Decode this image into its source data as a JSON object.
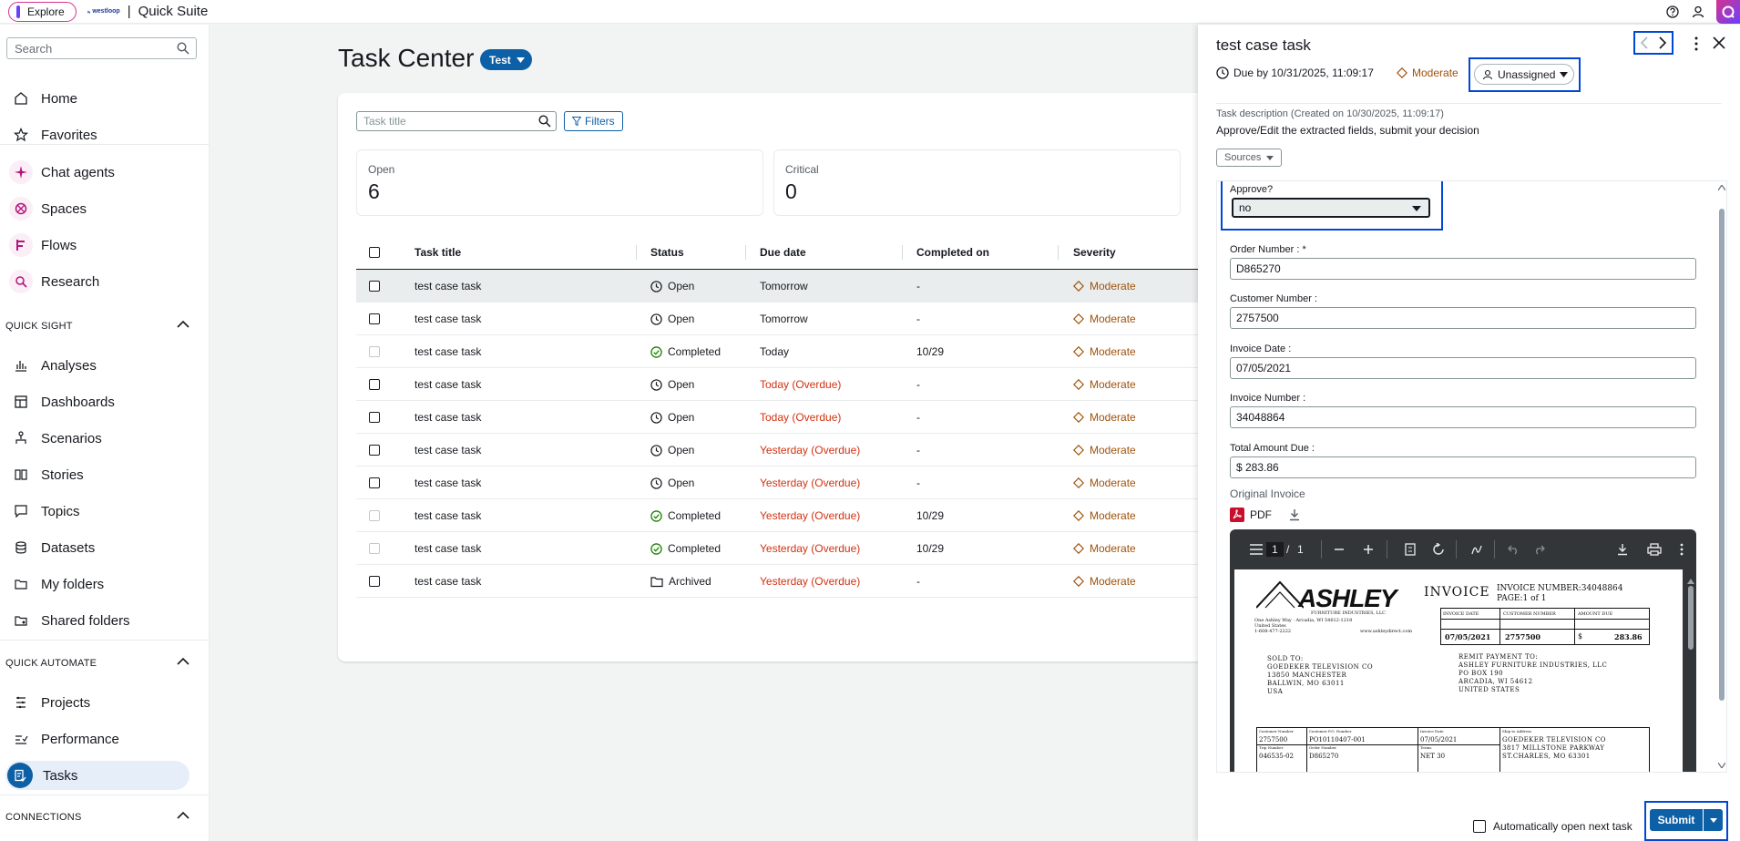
{
  "topbar": {
    "explore_label": "Explore",
    "brand_logo_text": "westloop",
    "brand_separator": "|",
    "app_name": "Quick Suite",
    "icons": [
      "help-icon",
      "user-icon",
      "quick-assistant-icon"
    ]
  },
  "sidebar": {
    "search_placeholder": "Search",
    "top_items": [
      {
        "label": "Home",
        "icon": "home-icon"
      },
      {
        "label": "Favorites",
        "icon": "star-icon"
      }
    ],
    "ai_items": [
      {
        "label": "Chat agents",
        "icon": "sparkle-icon"
      },
      {
        "label": "Spaces",
        "icon": "spaces-icon"
      },
      {
        "label": "Flows",
        "icon": "flows-icon"
      },
      {
        "label": "Research",
        "icon": "research-icon"
      }
    ],
    "quicksight_header": "QUICK SIGHT",
    "quicksight_items": [
      {
        "label": "Analyses"
      },
      {
        "label": "Dashboards"
      },
      {
        "label": "Scenarios"
      },
      {
        "label": "Stories"
      },
      {
        "label": "Topics"
      },
      {
        "label": "Datasets"
      },
      {
        "label": "My folders"
      },
      {
        "label": "Shared folders"
      }
    ],
    "automate_header": "QUICK AUTOMATE",
    "automate_items": [
      {
        "label": "Projects"
      },
      {
        "label": "Performance"
      },
      {
        "label": "Tasks"
      }
    ],
    "connections_header": "CONNECTIONS"
  },
  "main": {
    "title": "Task Center",
    "badge": "Test",
    "search_placeholder": "Task title",
    "filters_label": "Filters",
    "stats": [
      {
        "label": "Open",
        "value": "6"
      },
      {
        "label": "Critical",
        "value": "0"
      }
    ],
    "columns": [
      "Task title",
      "Status",
      "Due date",
      "Completed on",
      "Severity"
    ],
    "rows": [
      {
        "title": "test case task",
        "status": "Open",
        "status_icon": "clock-icon",
        "due": "Tomorrow",
        "overdue": false,
        "completed": "-",
        "severity": "Moderate",
        "selected": true
      },
      {
        "title": "test case task",
        "status": "Open",
        "status_icon": "clock-icon",
        "due": "Tomorrow",
        "overdue": false,
        "completed": "-",
        "severity": "Moderate"
      },
      {
        "title": "test case task",
        "status": "Completed",
        "status_icon": "check-circle-icon",
        "due": "Today",
        "overdue": false,
        "completed": "10/29",
        "severity": "Moderate"
      },
      {
        "title": "test case task",
        "status": "Open",
        "status_icon": "clock-icon",
        "due": "Today (Overdue)",
        "overdue": true,
        "completed": "-",
        "severity": "Moderate"
      },
      {
        "title": "test case task",
        "status": "Open",
        "status_icon": "clock-icon",
        "due": "Today (Overdue)",
        "overdue": true,
        "completed": "-",
        "severity": "Moderate"
      },
      {
        "title": "test case task",
        "status": "Open",
        "status_icon": "clock-icon",
        "due": "Yesterday (Overdue)",
        "overdue": true,
        "completed": "-",
        "severity": "Moderate"
      },
      {
        "title": "test case task",
        "status": "Open",
        "status_icon": "clock-icon",
        "due": "Yesterday (Overdue)",
        "overdue": true,
        "completed": "-",
        "severity": "Moderate"
      },
      {
        "title": "test case task",
        "status": "Completed",
        "status_icon": "check-circle-icon",
        "due": "Yesterday (Overdue)",
        "overdue": true,
        "completed": "10/29",
        "severity": "Moderate"
      },
      {
        "title": "test case task",
        "status": "Completed",
        "status_icon": "check-circle-icon",
        "due": "Yesterday (Overdue)",
        "overdue": true,
        "completed": "10/29",
        "severity": "Moderate"
      },
      {
        "title": "test case task",
        "status": "Archived",
        "status_icon": "folder-icon",
        "due": "Yesterday (Overdue)",
        "overdue": true,
        "completed": "-",
        "severity": "Moderate"
      }
    ]
  },
  "panel": {
    "title": "test case task",
    "due": "Due by 10/31/2025, 11:09:17",
    "severity": "Moderate",
    "assignee": "Unassigned",
    "description_label": "Task description (Created on 10/30/2025, 11:09:17)",
    "description": "Approve/Edit the extracted fields, submit your decision",
    "sources_label": "Sources",
    "approve_label": "Approve?",
    "approve_value": "no",
    "fields": [
      {
        "label": "Order Number : *",
        "value": "D865270"
      },
      {
        "label": "Customer Number :",
        "value": "2757500"
      },
      {
        "label": "Invoice Date :",
        "value": "07/05/2021"
      },
      {
        "label": "Invoice Number :",
        "value": "34048864"
      },
      {
        "label": "Total Amount Due :",
        "value": "$ 283.86"
      }
    ],
    "original_invoice_label": "Original Invoice",
    "pdf_label": "PDF",
    "pdf_viewer": {
      "page_current": "1",
      "page_sep": "/",
      "page_total": "1"
    },
    "invoice": {
      "brand": "ASHLEY",
      "brand_sub": "FURNITURE INDUSTRIES, LLC",
      "title": "INVOICE",
      "number_line": "INVOICE NUMBER:34048864",
      "page_line": "PAGE:1 of 1",
      "address_lines": [
        "One Ashley Way · Arcadia, WI 54612-1218",
        "United States",
        "1-608-477-2222"
      ],
      "website": "www.ashleydirect.com",
      "header_cells": [
        "INVOICE DATE",
        "CUSTOMER NUMBER",
        "AMOUNT DUE"
      ],
      "value_cells": [
        "07/05/2021",
        "2757500",
        "$",
        "283.86"
      ],
      "sold_to": [
        "SOLD TO:",
        "GOEDEKER TELEVISION CO",
        "13850 MANCHESTER",
        "BALLWIN, MO 63011",
        "USA"
      ],
      "remit_to": [
        "REMIT PAYMENT TO:",
        "ASHLEY FURNITURE INDUSTRIES, LLC",
        "PO BOX 190",
        "ARCADIA, WI 54612",
        "UNITED STATES"
      ],
      "grid_labels": [
        "Customer Number",
        "Customer P.O. Number",
        "Invoice Date",
        "Ship to Address",
        "Trip Number",
        "Order Number",
        "Terms"
      ],
      "grid_values": [
        "2757500",
        "PO10110407-001",
        "07/05/2021",
        "046535-02",
        "D865270",
        "NET 30"
      ],
      "ship_to": [
        "GOEDEKER TELEVISION CO",
        "3817 MILLSTONE PARKWAY",
        "ST.CHARLES, MO 63301"
      ]
    },
    "auto_open_label": "Automatically open next task",
    "submit_label": "Submit"
  },
  "colors": {
    "accent": "#0d5fa6",
    "highlight_box": "#0047d6",
    "overdue": "#d13212",
    "severity": "#a0520b",
    "brand_pink": "#d5338f",
    "brand_purple": "#6b40ff"
  }
}
